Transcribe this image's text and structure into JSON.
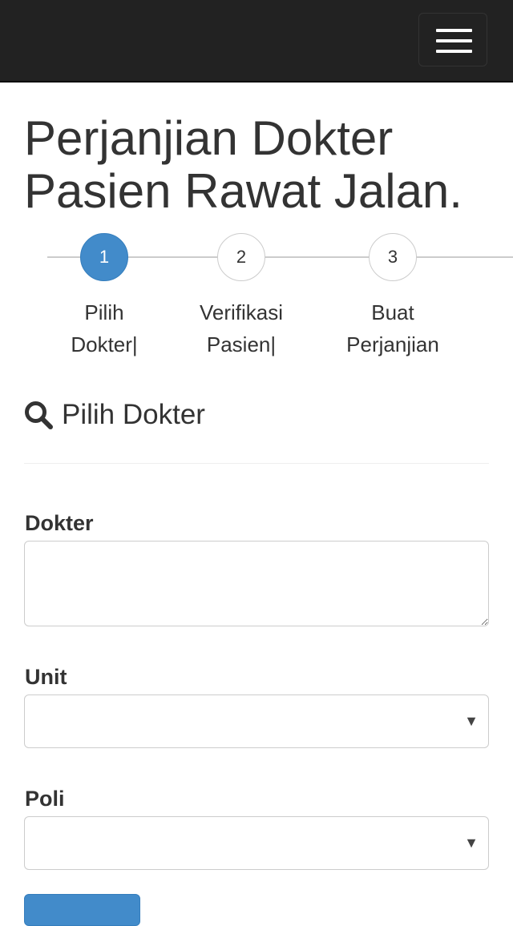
{
  "navbar": {
    "menu_toggle_icon": "hamburger-menu-icon"
  },
  "page": {
    "title_line1": "Perjanjian Dokter",
    "title_line2": "Pasien Rawat Jalan."
  },
  "steps": [
    {
      "number": "1",
      "label": "Pilih\nDokter|",
      "active": true
    },
    {
      "number": "2",
      "label": "Verifikasi\nPasien|",
      "active": false
    },
    {
      "number": "3",
      "label": "Buat\nPerjanjian",
      "active": false
    }
  ],
  "section": {
    "icon": "search-icon",
    "heading": "Pilih Dokter"
  },
  "form": {
    "dokter_label": "Dokter",
    "dokter_value": "",
    "unit_label": "Unit",
    "unit_selected": "",
    "poli_label": "Poli",
    "poli_selected": "",
    "select_caret": "▼"
  },
  "colors": {
    "navbar_bg": "#222222",
    "accent": "#428bca"
  }
}
